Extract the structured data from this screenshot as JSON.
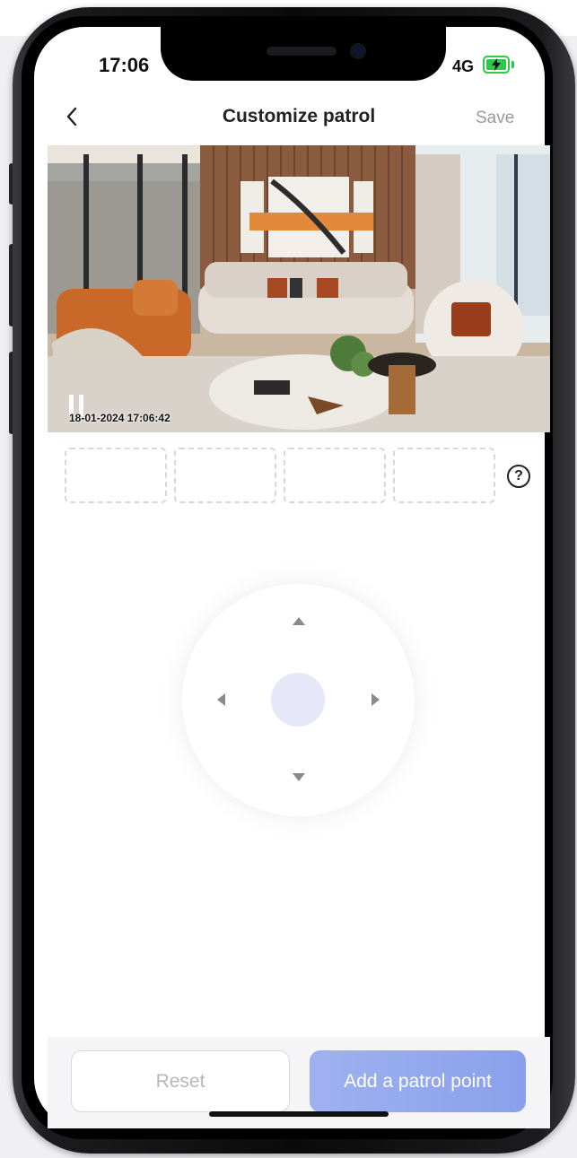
{
  "status_bar": {
    "time": "17:06",
    "network": "4G",
    "battery_icon": "battery-charging-icon"
  },
  "nav": {
    "title": "Customize patrol",
    "save_label": "Save",
    "back_icon": "chevron-left-icon"
  },
  "video": {
    "timestamp": "18-01-2024 17:06:42",
    "pause_icon": "pause-icon"
  },
  "patrol_slots": {
    "count": 4,
    "help_icon": "question-circle-icon",
    "help_glyph": "?"
  },
  "joystick": {
    "center_icon": "joystick-center",
    "arrows": [
      "arrow-up-icon",
      "arrow-down-icon",
      "arrow-left-icon",
      "arrow-right-icon"
    ]
  },
  "actions": {
    "reset_label": "Reset",
    "add_label": "Add a patrol point"
  },
  "colors": {
    "accent": "#8fa4ee",
    "battery": "#2ec94a",
    "joystick_center": "#e6e7f8"
  }
}
